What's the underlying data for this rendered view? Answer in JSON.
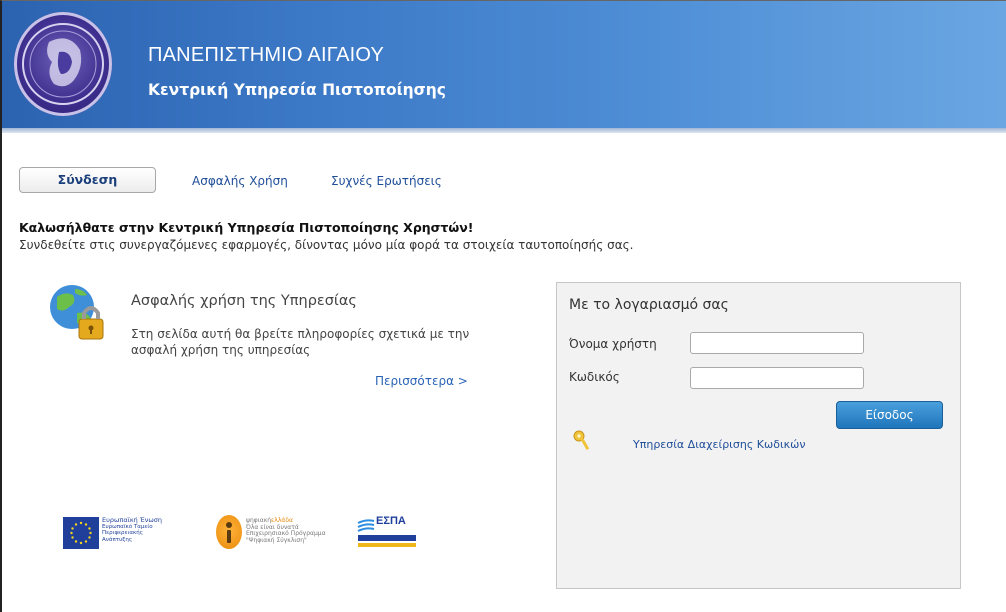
{
  "header": {
    "university": "ΠΑΝΕΠΙΣΤΗΜΙΟ ΑΙΓΑΙΟΥ",
    "service": "Κεντρική Υπηρεσία Πιστοποίησης",
    "gradient_start": "#2c63b0",
    "gradient_end": "#6aa6e2"
  },
  "nav": {
    "tabs": [
      {
        "label": "Σύνδεση",
        "active": true
      },
      {
        "label": "Ασφαλής Χρήση",
        "active": false
      },
      {
        "label": "Συχνές Ερωτήσεις",
        "active": false
      }
    ]
  },
  "welcome": {
    "title": "Καλωσήλθατε στην Κεντρική Υπηρεσία Πιστοποίησης Χρηστών!",
    "text": "Συνδεθείτε στις συνεργαζόμενες εφαρμογές, δίνοντας μόνο μία φορά τα στοιχεία ταυτοποίησής σας."
  },
  "security": {
    "icon": "globe-lock-icon",
    "title": "Ασφαλής χρήση της Υπηρεσίας",
    "text": "Στη σελίδα αυτή θα βρείτε πληροφορίες σχετικά με την ασφαλή χρήση της υπηρεσίας",
    "more_link": "Περισσότερα >"
  },
  "login": {
    "title": "Με το λογαριασμό σας",
    "username_label": "Όνομα χρήστη",
    "username_value": "",
    "password_label": "Κωδικός",
    "password_value": "",
    "submit_label": "Είσοδος",
    "password_management_link": "Υπηρεσία Διαχείρισης Κωδικών",
    "key_icon": "key-icon",
    "button_color": "#1f75bb"
  },
  "footer_logos": {
    "eu_lines": [
      "Ευρωπαϊκή Ένωση",
      "Ευρωπαϊκό Ταμείο",
      "Περιφερειακής",
      "Ανάπτυξης"
    ],
    "digital_lines_1": "ψηφιακή",
    "digital_lines_1b": "ελλάδα",
    "digital_lines_2": "Όλα είναι δυνατά",
    "digital_lines_3": "Επιχειρησιακό Πρόγραμμα",
    "digital_lines_4": "\"Ψηφιακή Σύγκλιση\"",
    "espa": "ΕΣΠΑ"
  }
}
